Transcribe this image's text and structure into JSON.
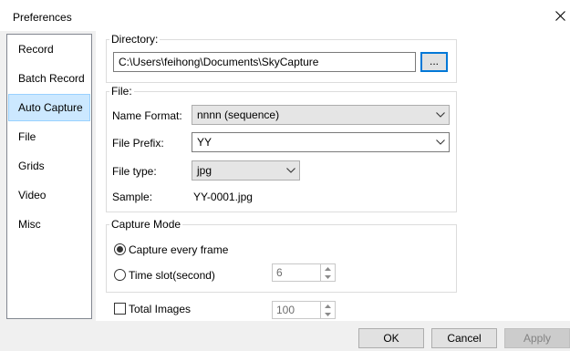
{
  "window": {
    "title": "Preferences"
  },
  "sidebar": {
    "items": [
      {
        "label": "Record"
      },
      {
        "label": "Batch Record"
      },
      {
        "label": "Auto Capture"
      },
      {
        "label": "File"
      },
      {
        "label": "Grids"
      },
      {
        "label": "Video"
      },
      {
        "label": "Misc"
      }
    ],
    "selected": "Auto Capture"
  },
  "directory": {
    "group_title": "Directory:",
    "path": "C:\\Users\\feihong\\Documents\\SkyCapture",
    "browse_label": "..."
  },
  "file": {
    "group_title": "File:",
    "name_format_label": "Name Format:",
    "name_format_value": "nnnn (sequence)",
    "prefix_label": "File Prefix:",
    "prefix_value": "YY",
    "type_label": "File type:",
    "type_value": "jpg",
    "sample_label": "Sample:",
    "sample_value": "YY-0001.jpg"
  },
  "capture_mode": {
    "group_title": "Capture Mode",
    "every_frame_label": "Capture every frame",
    "every_frame_selected": true,
    "time_slot_label": "Time slot(second)",
    "time_slot_selected": false,
    "time_slot_value": "6"
  },
  "total_images": {
    "label": "Total Images",
    "checked": false,
    "value": "100"
  },
  "footer": {
    "ok_label": "OK",
    "cancel_label": "Cancel",
    "apply_label": "Apply"
  },
  "colors": {
    "selection_bg": "#cce8ff",
    "selection_border": "#99d1ff",
    "default_button_border": "#0078d7"
  }
}
